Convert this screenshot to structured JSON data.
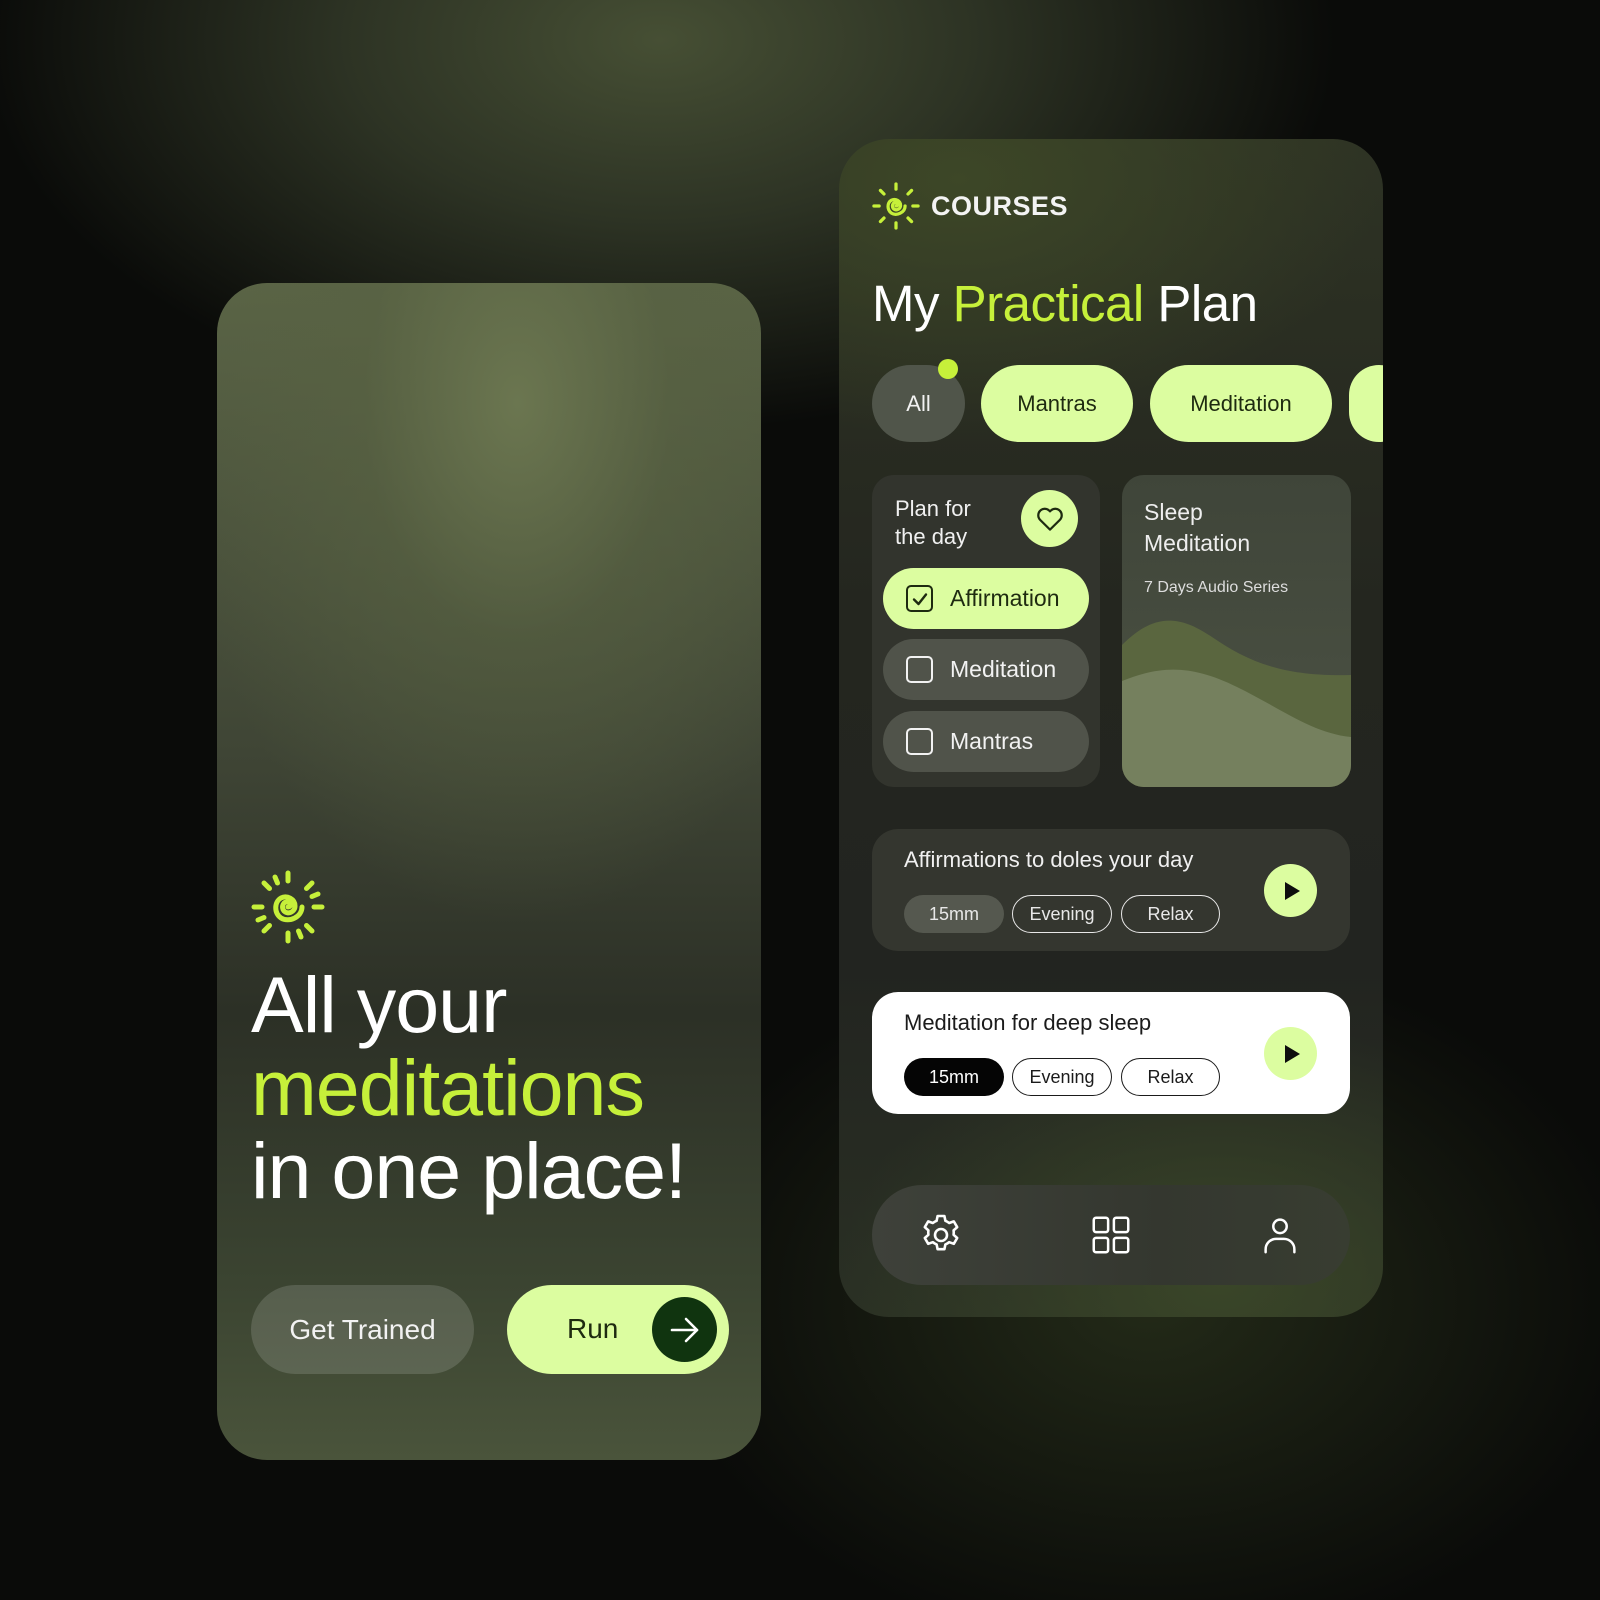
{
  "colors": {
    "accent": "#c6f03a",
    "chip_light": "#dcfda0",
    "dark_green": "#10340f"
  },
  "onboarding": {
    "logo_icon": "sun-spiral-icon",
    "headline_line1": "All your",
    "headline_accent": "meditations",
    "headline_line3": "in one place!",
    "secondary_button": "Get Trained",
    "primary_button": "Run",
    "primary_button_icon": "arrow-right-icon"
  },
  "courses": {
    "logo_icon": "sun-spiral-icon",
    "section_label": "COURSES",
    "title_prefix": "My",
    "title_accent": "Practical",
    "title_suffix": "Plan",
    "filter_chips": [
      "All",
      "Mantras",
      "Meditation"
    ],
    "plan_card": {
      "title": "Plan for the day",
      "favorite_icon": "heart-icon",
      "tasks": [
        {
          "label": "Affirmation",
          "checked": true
        },
        {
          "label": "Meditation",
          "checked": false
        },
        {
          "label": "Mantras",
          "checked": false
        }
      ]
    },
    "sleep_card": {
      "title": "Sleep Meditation",
      "subtitle": "7 Days Audio Series"
    },
    "sessions": [
      {
        "title": "Affirmations to doles  your day",
        "tags": [
          "15mm",
          "Evening",
          "Relax"
        ],
        "play_icon": "play-icon"
      },
      {
        "title": "Meditation for deep sleep",
        "tags": [
          "15mm",
          "Evening",
          "Relax"
        ],
        "play_icon": "play-icon"
      }
    ],
    "nav_icons": [
      "gear-icon",
      "grid-icon",
      "user-icon"
    ]
  }
}
